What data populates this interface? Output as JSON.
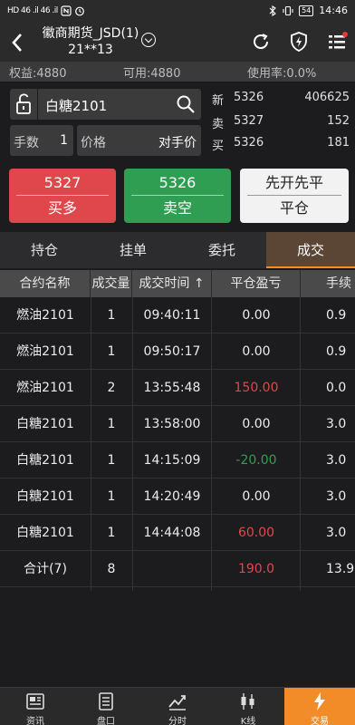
{
  "status_bar": {
    "time": "14:46",
    "battery": "54",
    "signal_left": "HD 46 .il 46 .il"
  },
  "header": {
    "title_line1": "徽商期货_JSD(1)",
    "title_line2": "21**13"
  },
  "account": {
    "equity": "权益:4880",
    "available": "可用:4880",
    "usage": "使用率:0.0%"
  },
  "order": {
    "symbol": "白糖2101",
    "qty_label": "手数",
    "qty_value": "1",
    "price_label": "价格",
    "price_value": "对手价"
  },
  "quotes": [
    {
      "label": "新",
      "price": "5326",
      "volume": "406625"
    },
    {
      "label": "卖",
      "price": "5327",
      "volume": "152"
    },
    {
      "label": "买",
      "price": "5326",
      "volume": "181"
    }
  ],
  "actions": {
    "buy": {
      "price": "5327",
      "label": "买多"
    },
    "sell": {
      "price": "5326",
      "label": "卖空"
    },
    "close": {
      "price": "先开先平",
      "label": "平仓"
    }
  },
  "tabs": [
    "持仓",
    "挂单",
    "委托",
    "成交"
  ],
  "active_tab": "成交",
  "table": {
    "headers": [
      "合约名称",
      "成交量",
      "成交时间 ↑",
      "平仓盈亏",
      "手续"
    ],
    "rows": [
      [
        "燃油2101",
        "1",
        "09:40:11",
        "0.00",
        "0.9"
      ],
      [
        "燃油2101",
        "1",
        "09:50:17",
        "0.00",
        "0.9"
      ],
      [
        "燃油2101",
        "2",
        "13:55:48",
        "150.00",
        "0.0"
      ],
      [
        "白糖2101",
        "1",
        "13:58:00",
        "0.00",
        "3.0"
      ],
      [
        "白糖2101",
        "1",
        "14:15:09",
        "-20.00",
        "3.0"
      ],
      [
        "白糖2101",
        "1",
        "14:20:49",
        "0.00",
        "3.0"
      ],
      [
        "白糖2101",
        "1",
        "14:44:08",
        "60.00",
        "3.0"
      ],
      [
        "合计(7)",
        "8",
        "",
        "190.0",
        "13.9"
      ]
    ]
  },
  "colors": {
    "up": "#e0474c",
    "down": "#2f9e52",
    "accent": "#f28c28"
  },
  "nav": [
    {
      "label": "资讯",
      "icon": "news-icon"
    },
    {
      "label": "盘口",
      "icon": "orderbook-icon"
    },
    {
      "label": "分时",
      "icon": "timeshare-icon"
    },
    {
      "label": "K线",
      "icon": "kline-icon"
    },
    {
      "label": "交易",
      "icon": "trade-icon"
    }
  ]
}
